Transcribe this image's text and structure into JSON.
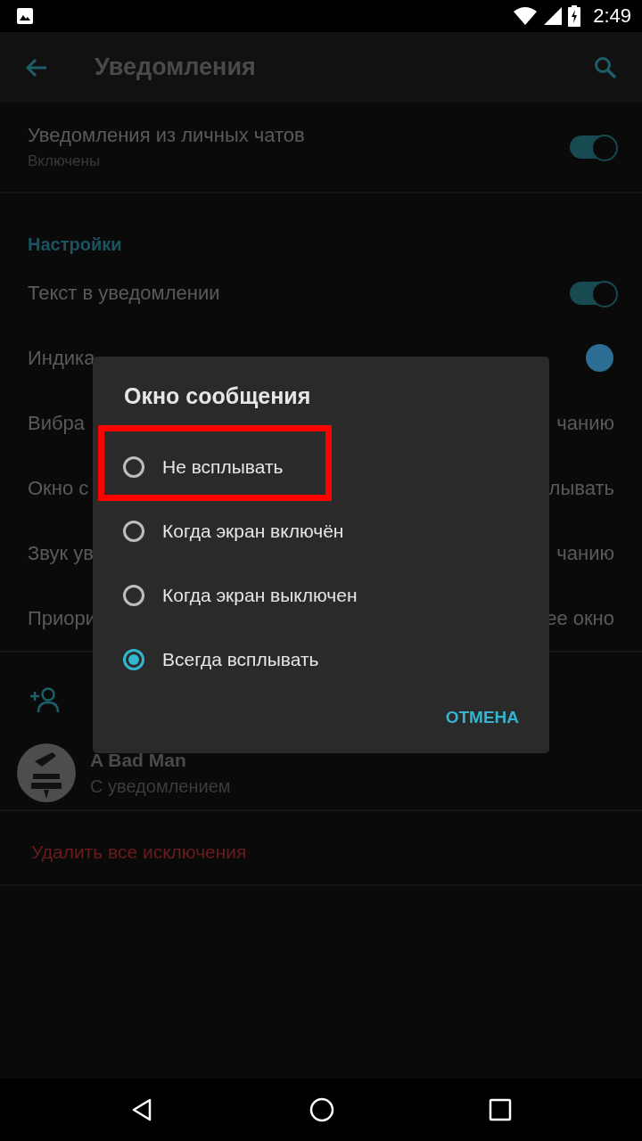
{
  "status_bar": {
    "time": "2:49"
  },
  "toolbar": {
    "title": "Уведомления"
  },
  "private_chats": {
    "title": "Уведомления из личных чатов",
    "subtitle": "Включены",
    "on": true
  },
  "settings": {
    "header": "Настройки",
    "rows": [
      {
        "kind": "toggle",
        "label": "Текст в уведомлении",
        "on": true
      },
      {
        "kind": "dot",
        "label": "Индика",
        "color": "#2d6f94"
      },
      {
        "kind": "value",
        "label": "Вибра",
        "value": "чанию"
      },
      {
        "kind": "value",
        "label": "Окно с",
        "value": "лывать"
      },
      {
        "kind": "value",
        "label": "Звук ув",
        "value": "чанию"
      },
      {
        "kind": "value",
        "label": "Приори",
        "value": "ее окно"
      }
    ]
  },
  "exceptions": {
    "contact": {
      "name": "A Bad Man",
      "status": "С уведомлением"
    },
    "delete_label": "Удалить все исключения"
  },
  "dialog": {
    "title": "Окно сообщения",
    "options": [
      {
        "label": "Не всплывать",
        "selected": false,
        "highlighted": true
      },
      {
        "label": "Когда экран включён",
        "selected": false,
        "highlighted": false
      },
      {
        "label": "Когда экран выключен",
        "selected": false,
        "highlighted": false
      },
      {
        "label": "Всегда всплывать",
        "selected": true,
        "highlighted": false
      }
    ],
    "cancel": "ОТМЕНА"
  }
}
